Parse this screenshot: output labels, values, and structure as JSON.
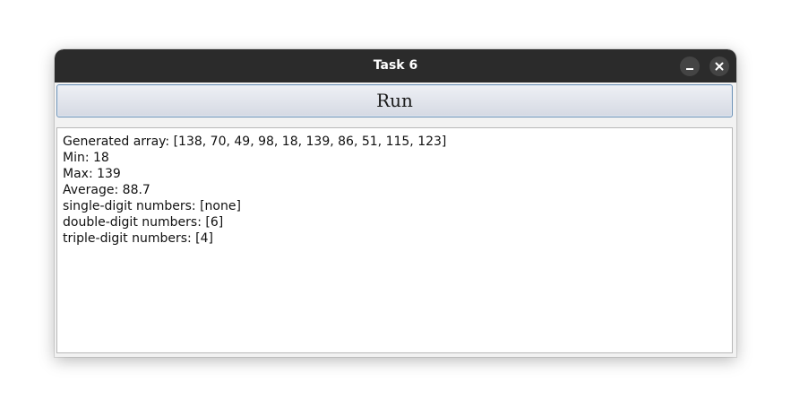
{
  "window": {
    "title": "Task 6",
    "minimize_icon": "minimize-icon",
    "close_icon": "close-icon"
  },
  "run_button": {
    "label": "Run"
  },
  "output": {
    "lines": [
      "Generated array: [138, 70, 49, 98, 18, 139, 86, 51, 115, 123]",
      "Min: 18",
      "Max: 139",
      "Average: 88.7",
      "single-digit numbers: [none]",
      "double-digit numbers: [6]",
      "triple-digit numbers: [4]"
    ]
  },
  "colors": {
    "titlebar": "#2b2b2b",
    "button_border": "#6f93b8",
    "text": "#111111"
  }
}
